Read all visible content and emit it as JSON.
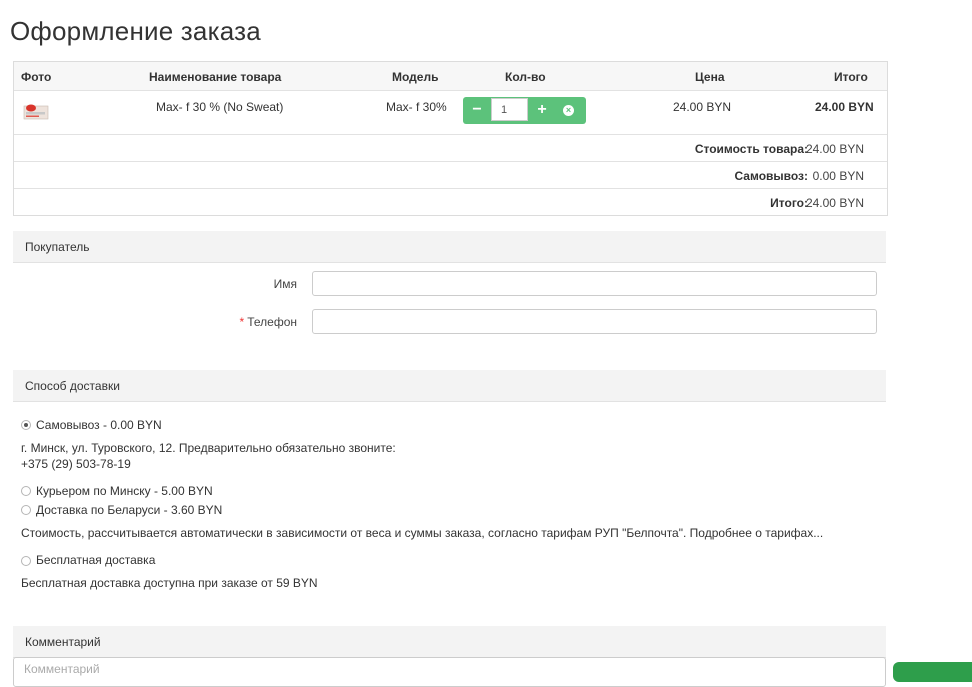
{
  "page_title": "Оформление заказа",
  "cart": {
    "headers": {
      "photo": "Фото",
      "name": "Наименование товара",
      "model": "Модель",
      "qty": "Кол-во",
      "price": "Цена",
      "total": "Итого"
    },
    "item": {
      "name": "Max- f 30 % (No Sweat)",
      "model": "Max- f 30%",
      "quantity": "1",
      "price": "24.00 BYN",
      "total": "24.00 BYN",
      "minus": "−",
      "plus": "+",
      "remove": "×"
    },
    "summary": [
      {
        "label": "Стоимость товара:",
        "value": "24.00 BYN"
      },
      {
        "label": "Самовывоз:",
        "value": "0.00 BYN"
      },
      {
        "label": "Итого:",
        "value": "24.00 BYN"
      }
    ]
  },
  "buyer": {
    "title": "Покупатель",
    "name_label": "Имя",
    "phone_label": "Телефон",
    "required_mark": "*"
  },
  "delivery": {
    "title": "Способ доставки",
    "options": [
      {
        "label": "Самовывоз - 0.00 BYN",
        "selected": true
      },
      {
        "label": "Курьером по Минску - 5.00 BYN",
        "selected": false
      },
      {
        "label": "Доставка по Беларуси - 3.60 BYN",
        "selected": false
      },
      {
        "label": "Бесплатная доставка",
        "selected": false
      }
    ],
    "pickup_note_line1": "г. Минск, ул. Туровского, 12. Предварительно обязательно звоните:",
    "pickup_note_line2": "+375 (29) 503-78-19",
    "post_note": "Стоимость, рассчитывается автоматически в зависимости от веса и суммы заказа, согласно тарифам РУП \"Белпочта\". Подробнее о тарифах...",
    "free_note": "Бесплатная доставка доступна при заказе от 59 BYN"
  },
  "comment": {
    "title": "Комментарий",
    "placeholder": "Комментарий"
  },
  "colors": {
    "accent_green": "#5cc27b",
    "dark_green": "#2e9e4b",
    "required_red": "#e33333"
  }
}
